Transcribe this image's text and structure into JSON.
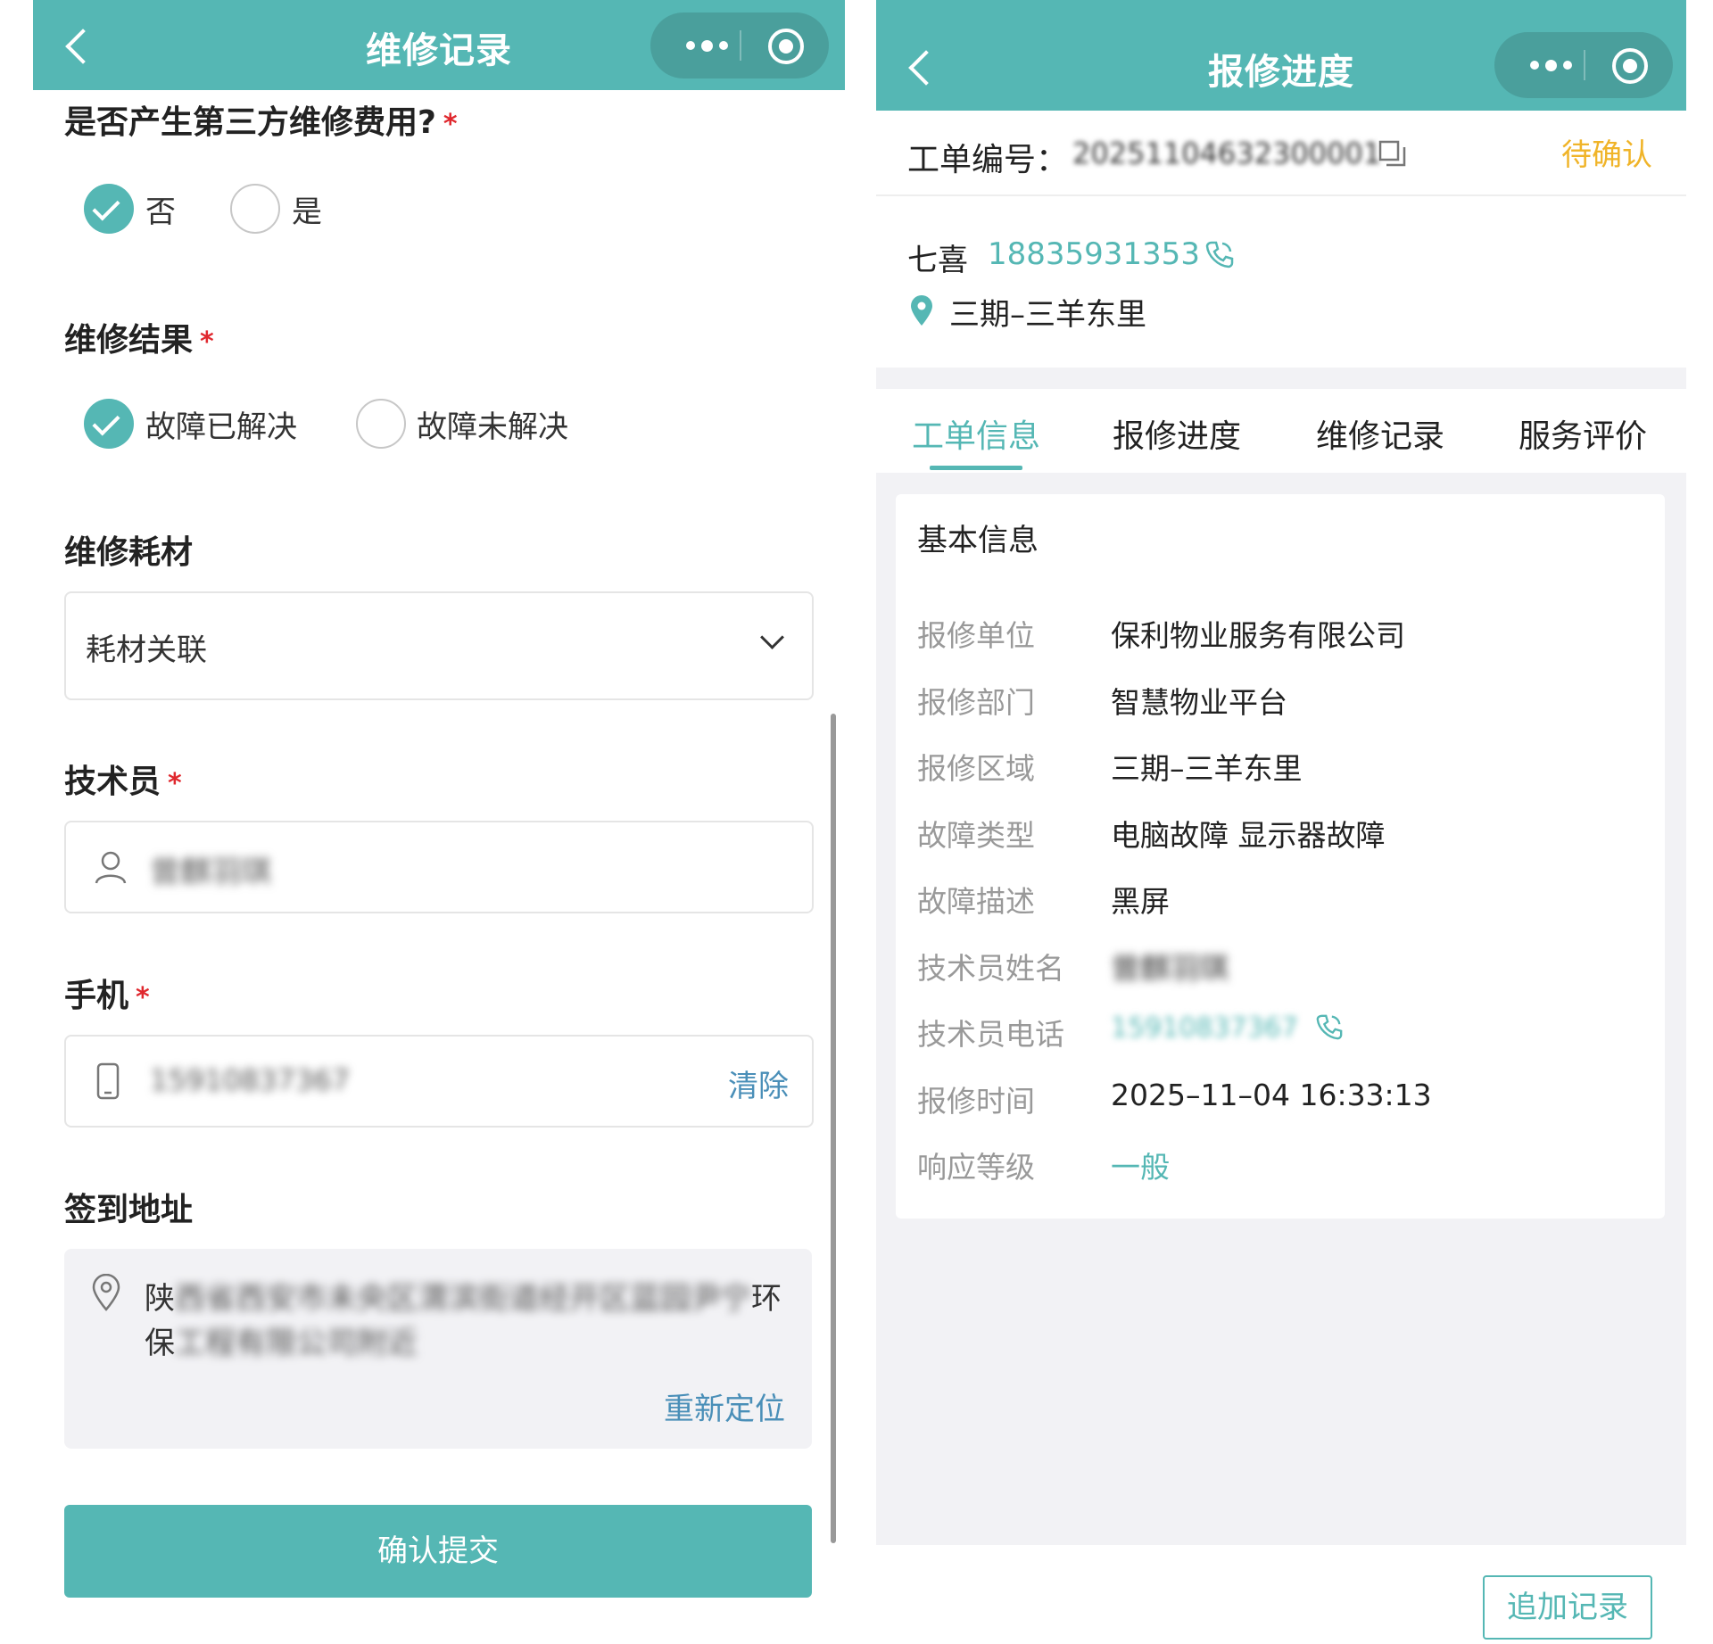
{
  "left": {
    "header": {
      "title": "维修记录"
    },
    "third_party": {
      "label": "是否产生第三方维修费用?",
      "required": "*",
      "options": [
        "否",
        "是"
      ],
      "selected": "否"
    },
    "result": {
      "label": "维修结果",
      "required": "*",
      "options": [
        "故障已解决",
        "故障未解决"
      ],
      "selected": "故障已解决"
    },
    "materials": {
      "label": "维修耗材",
      "select_value": "耗材关联"
    },
    "technician": {
      "label": "技术员",
      "required": "*",
      "value": "曾麒羽琪"
    },
    "phone": {
      "label": "手机",
      "required": "*",
      "value": "15910837367",
      "clear_label": "清除"
    },
    "checkin": {
      "label": "签到地址",
      "address_line1_start": "陕",
      "address_line1_hidden": "西省西安市未央区渭滨街道经开区蓝园尹宁",
      "address_line1_end": "环",
      "address_line2_start": "保",
      "address_line2_hidden": "工程有限公司附近",
      "relocate_label": "重新定位"
    },
    "submit_label": "确认提交"
  },
  "right": {
    "header": {
      "title": "报修进度"
    },
    "order": {
      "label": "工单编号：",
      "number": "20251104632300001",
      "status": "待确认"
    },
    "contact": {
      "name": "七喜",
      "phone": "18835931353",
      "location": "三期–三羊东里"
    },
    "tabs": [
      "工单信息",
      "报修进度",
      "维修记录",
      "服务评价"
    ],
    "active_tab": "工单信息",
    "basic": {
      "title": "基本信息",
      "rows": [
        {
          "k": "报修单位",
          "v": "保利物业服务有限公司"
        },
        {
          "k": "报修部门",
          "v": "智慧物业平台"
        },
        {
          "k": "报修区域",
          "v": "三期–三羊东里"
        },
        {
          "k": "故障类型",
          "v": "电脑故障 显示器故障"
        },
        {
          "k": "故障描述",
          "v": "黑屏"
        },
        {
          "k": "技术员姓名",
          "v": "曾麒羽琪"
        },
        {
          "k": "技术员电话",
          "v": "15910837367"
        },
        {
          "k": "报修时间",
          "v": "2025–11–04 16:33:13"
        },
        {
          "k": "响应等级",
          "v": "一般"
        }
      ]
    },
    "add_record_label": "追加记录"
  },
  "colors": {
    "accent": "#55b7b4",
    "required": "#e0282e",
    "pending": "#f0b429",
    "link": "#4a8fb8"
  },
  "icons": [
    "back-icon",
    "more-icon",
    "target-icon",
    "check-icon",
    "user-icon",
    "mobile-icon",
    "location-icon",
    "copy-icon",
    "phone-call-icon",
    "chevron-down-icon"
  ]
}
